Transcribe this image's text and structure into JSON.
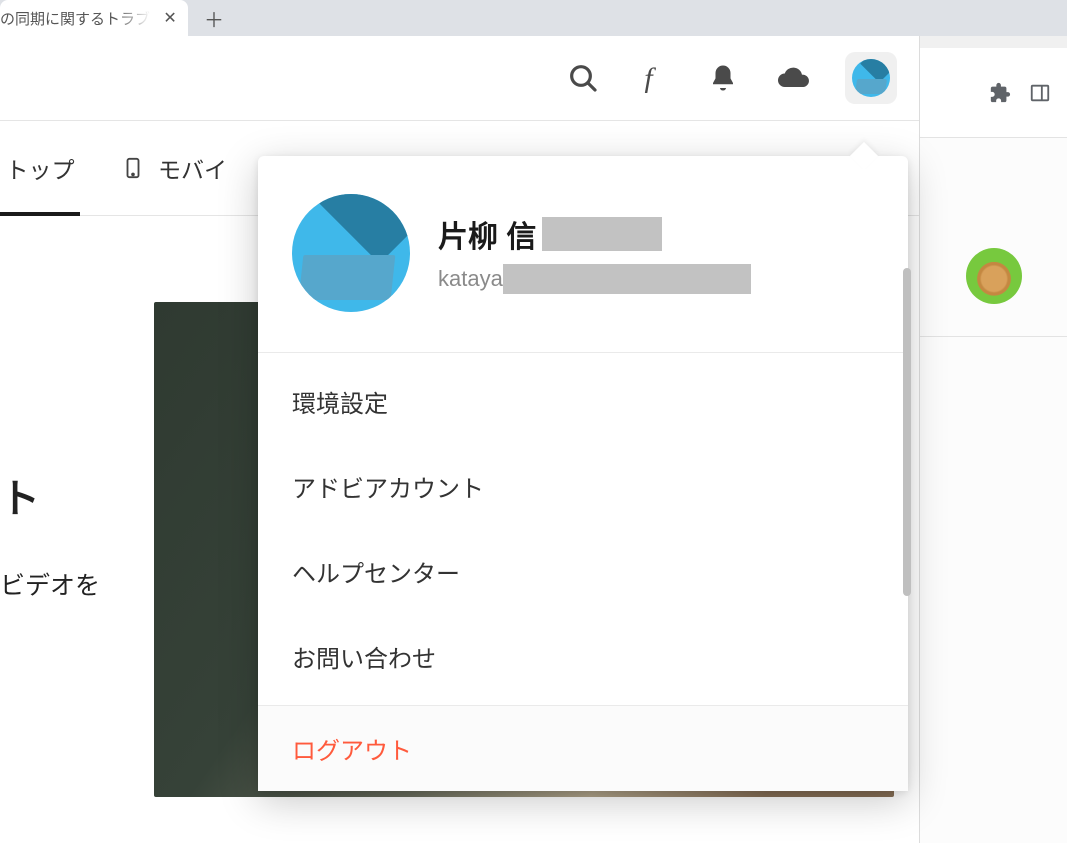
{
  "browser": {
    "tab_title": "の同期に関するトラブ",
    "close_glyph": "✕",
    "new_tab_glyph": "＋"
  },
  "topbar": {
    "search_name": "search-icon",
    "fonts_name": "fonts-icon",
    "bell_name": "bell-icon",
    "cloud_name": "cloud-icon",
    "profile_name": "profile-button"
  },
  "nav": {
    "top_label": "トップ",
    "mobile_label": "モバイ"
  },
  "page": {
    "side_line1": "ト",
    "side_line2": "ビデオを"
  },
  "user": {
    "name_visible": "片柳 信",
    "email_visible": "kataya"
  },
  "menu": {
    "items": [
      {
        "label": "環境設定"
      },
      {
        "label": "アドビアカウント"
      },
      {
        "label": "ヘルプセンター"
      },
      {
        "label": "お問い合わせ"
      }
    ],
    "logout_label": "ログアウト"
  },
  "colors": {
    "accent_avatar": "#3fb8ea",
    "logout": "#ff5a3c"
  }
}
